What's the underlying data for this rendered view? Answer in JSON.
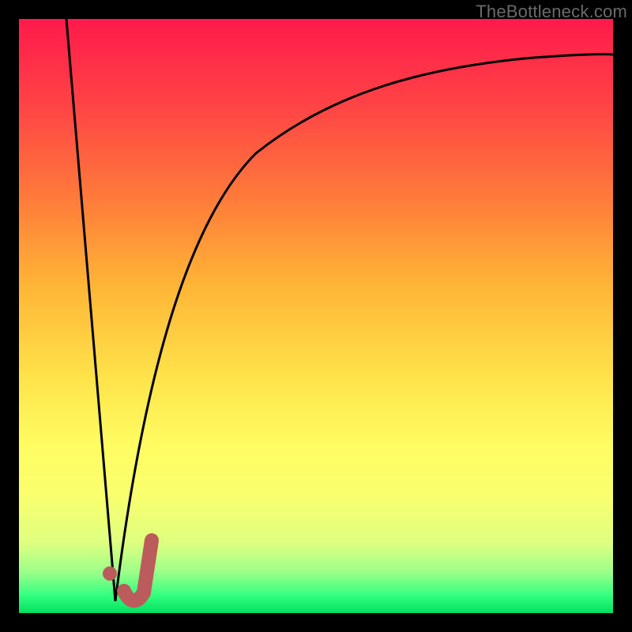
{
  "watermark": "TheBottleneck.com",
  "chart_data": {
    "type": "line",
    "title": "",
    "xlabel": "",
    "ylabel": "",
    "xlim": [
      0,
      100
    ],
    "ylim": [
      0,
      100
    ],
    "grid": false,
    "legend": false,
    "series": [
      {
        "name": "curve-left",
        "color": "#000000",
        "x": [
          8,
          13.8,
          16.2
        ],
        "y": [
          100,
          50,
          2
        ]
      },
      {
        "name": "curve-right",
        "color": "#000000",
        "x": [
          16.2,
          20,
          25,
          30,
          40,
          50,
          65,
          80,
          100
        ],
        "y": [
          2,
          30,
          55,
          68,
          80,
          86,
          90,
          92.5,
          94
        ]
      },
      {
        "name": "mark-j-stroke",
        "color": "#bb5b5c",
        "x": [
          18,
          19.5,
          21,
          22
        ],
        "y": [
          3,
          2.5,
          4,
          13
        ]
      },
      {
        "name": "mark-dot",
        "color": "#bb5b5c",
        "x": [
          15.5
        ],
        "y": [
          6
        ]
      }
    ]
  }
}
